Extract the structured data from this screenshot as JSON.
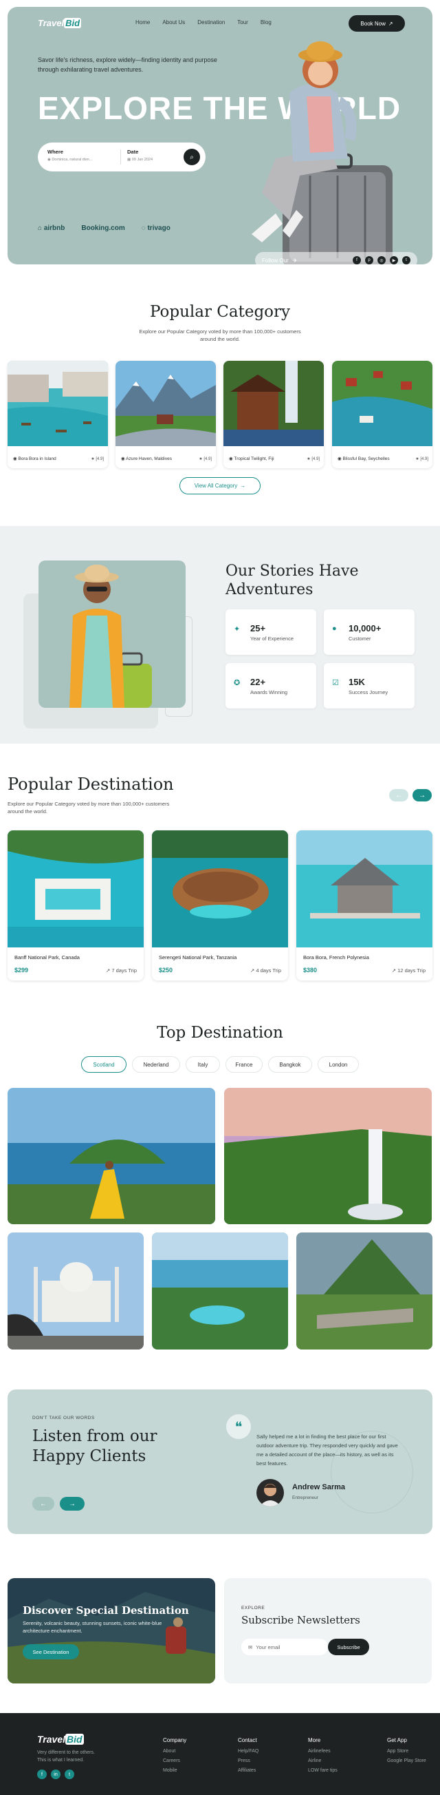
{
  "brand": {
    "logo_main": "Travel",
    "logo_accent": "Bid",
    "accent_color": "#1a8f8a",
    "dark_color": "#1d2323"
  },
  "nav": {
    "items": [
      "Home",
      "About Us",
      "Destination",
      "Tour",
      "Blog"
    ],
    "book_label": "Book Now"
  },
  "hero": {
    "subtitle": "Savor life's richness, explore widely—finding identity and purpose through exhilarating travel adventures.",
    "title": "EXPLORE THE WORLD",
    "where_label": "Where",
    "where_value": "Dominica, natural disn...",
    "date_label": "Date",
    "date_value": "09 Jan 2024",
    "partners": [
      "airbnb",
      "Booking.com",
      "trivago"
    ],
    "follow_label": "Follow Our"
  },
  "category": {
    "title": "Popular Category",
    "description": "Explore our Popular Category voted by more than 100,000+ customers around the world.",
    "cards": [
      {
        "name": "Bora Bora in Island",
        "rating": "4.9"
      },
      {
        "name": "Azure Haven, Maldives",
        "rating": "4.9"
      },
      {
        "name": "Tropical Twilight, Fiji",
        "rating": "4.9"
      },
      {
        "name": "Blissful Bay, Seychelles",
        "rating": "4.9"
      }
    ],
    "view_all": "View All Category"
  },
  "stories": {
    "title": "Our Stories Have Adventures",
    "stats": [
      {
        "value": "25+",
        "label": "Year of Experience",
        "icon": "rocket-icon"
      },
      {
        "value": "10,000+",
        "label": "Customer",
        "icon": "people-icon"
      },
      {
        "value": "22+",
        "label": "Awards Winning",
        "icon": "award-icon"
      },
      {
        "value": "15K",
        "label": "Success Journey",
        "icon": "check-icon"
      }
    ]
  },
  "popular": {
    "title": "Popular Destination",
    "description": "Explore our Popular Category voted by more than 100,000+ customers around the world.",
    "cards": [
      {
        "name": "Banff National Park, Canada",
        "price": "$299",
        "days": "7 days Trip"
      },
      {
        "name": "Serengeti National Park, Tanzania",
        "price": "$250",
        "days": "4 days Trip"
      },
      {
        "name": "Bora Bora, French Polynesia",
        "price": "$380",
        "days": "12 days Trip"
      }
    ]
  },
  "top": {
    "title": "Top Destination",
    "tabs": [
      "Scotland",
      "Nederland",
      "Italy",
      "France",
      "Bangkok",
      "London"
    ],
    "active_tab": "Scotland"
  },
  "clients": {
    "kicker": "DON'T TAKE OUR WORDS",
    "title": "Listen from our Happy Clients",
    "quote": "Sally helped me a lot in finding the best place for our first outdoor adventure trip. They responded very quickly and gave me a detailed account of the place—its history, as well as its best features.",
    "name": "Andrew Sarma",
    "role": "Entrepreneur"
  },
  "discover": {
    "title": "Discover Special Destination",
    "text": "Serenity, volcanic beauty, stunning sunsets, iconic white-blue architecture enchantment.",
    "button": "See Destination"
  },
  "newsletter": {
    "kicker": "EXPLORE",
    "title": "Subscribe Newsletters",
    "placeholder": "Your email",
    "button": "Subscribe"
  },
  "footer": {
    "tagline_1": "Very different to the others.",
    "tagline_2": "This is what I learned.",
    "columns": [
      {
        "heading": "Company",
        "links": [
          "About",
          "Careers",
          "Mobile"
        ]
      },
      {
        "heading": "Contact",
        "links": [
          "Help/FAQ",
          "Press",
          "Affiliates"
        ]
      },
      {
        "heading": "More",
        "links": [
          "Airlinefees",
          "Airline",
          "LOW fare tips"
        ]
      },
      {
        "heading": "Get App",
        "links": [
          "App Store",
          "Google Play Store"
        ]
      }
    ]
  }
}
